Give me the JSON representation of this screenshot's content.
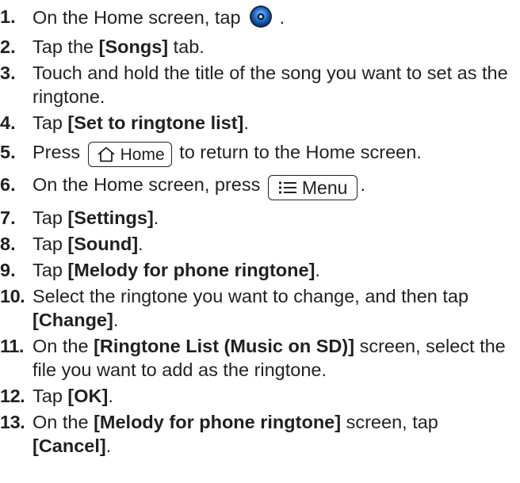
{
  "steps": [
    {
      "num": "1.",
      "before": "On the Home screen, tap ",
      "icon": "music-player-icon",
      "after": "."
    },
    {
      "num": "2.",
      "before": "Tap ",
      "bold": "[Songs]",
      "after": " tab.",
      "pre": "the "
    },
    {
      "num": "3.",
      "text": "Touch and hold the title of the song you want to set as the ringtone."
    },
    {
      "num": "4.",
      "before": "Tap ",
      "bold": "[Set to ringtone list]",
      "after": "."
    },
    {
      "num": "5.",
      "before": "Press ",
      "key": {
        "label": "Home",
        "icon": "home-icon"
      },
      "after": " to return to the Home screen."
    },
    {
      "num": "6.",
      "before": "On the Home screen, press ",
      "key": {
        "label": "Menu",
        "icon": "menu-icon"
      },
      "after": "."
    },
    {
      "num": "7.",
      "before": "Tap ",
      "bold": "[Settings]",
      "after": "."
    },
    {
      "num": "8.",
      "before": "Tap ",
      "bold": "[Sound]",
      "after": "."
    },
    {
      "num": "9.",
      "before": "Tap ",
      "bold": "[Melody for phone ringtone]",
      "after": "."
    },
    {
      "num": "10.",
      "before": "Select the ringtone you want to change, and then tap ",
      "bold": "[Change]",
      "after": "."
    },
    {
      "num": "11.",
      "before": "On the ",
      "bold": "[Ringtone List (Music on SD)]",
      "after": " screen, select the file you want to add as the ringtone."
    },
    {
      "num": "12.",
      "before": "Tap ",
      "bold": "[OK]",
      "after": "."
    },
    {
      "num": "13.",
      "before": "On the ",
      "bold": "[Melody for phone ringtone]",
      "mid": " screen, tap ",
      "bold2": "[Cancel]",
      "after": "."
    }
  ]
}
